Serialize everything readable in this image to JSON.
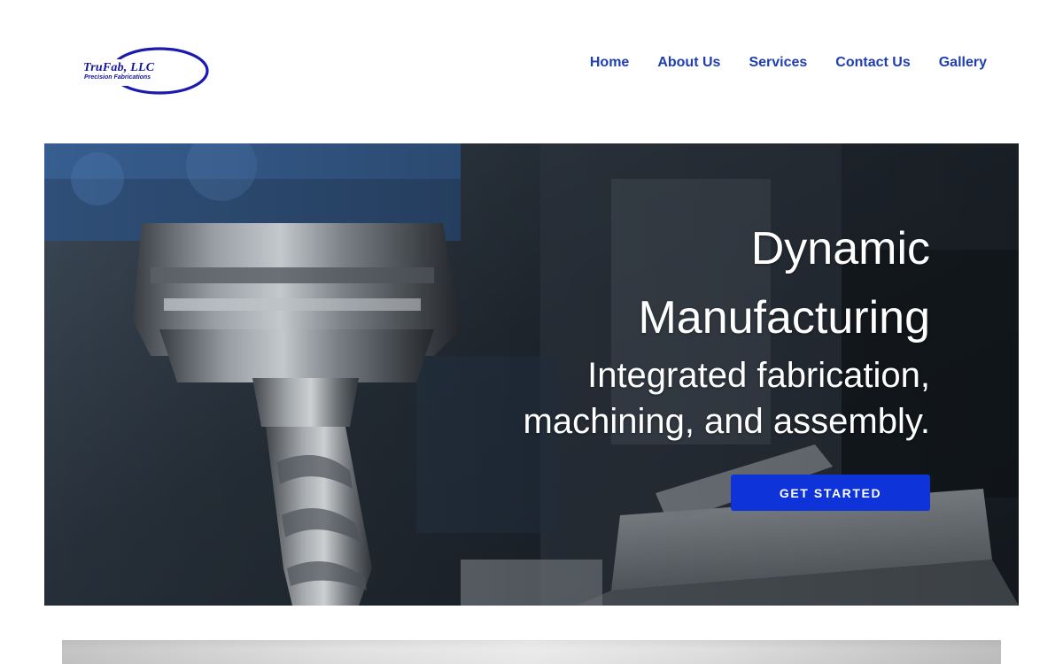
{
  "brand": {
    "name": "TruFab, LLC",
    "tagline": "Precision Fabrications",
    "color": "#16169a"
  },
  "nav": {
    "items": [
      {
        "label": "Home"
      },
      {
        "label": "About Us"
      },
      {
        "label": "Services"
      },
      {
        "label": "Contact Us"
      },
      {
        "label": "Gallery"
      }
    ],
    "color": "#1f3fb0"
  },
  "hero": {
    "title_line1": "Dynamic",
    "title_line2": "Manufacturing",
    "subtitle_line1": "Integrated fabrication,",
    "subtitle_line2": "machining, and assembly.",
    "cta_label": "GET STARTED",
    "cta_color": "#0d33d9",
    "image_subject": "milling machine end mill cutting tool"
  }
}
